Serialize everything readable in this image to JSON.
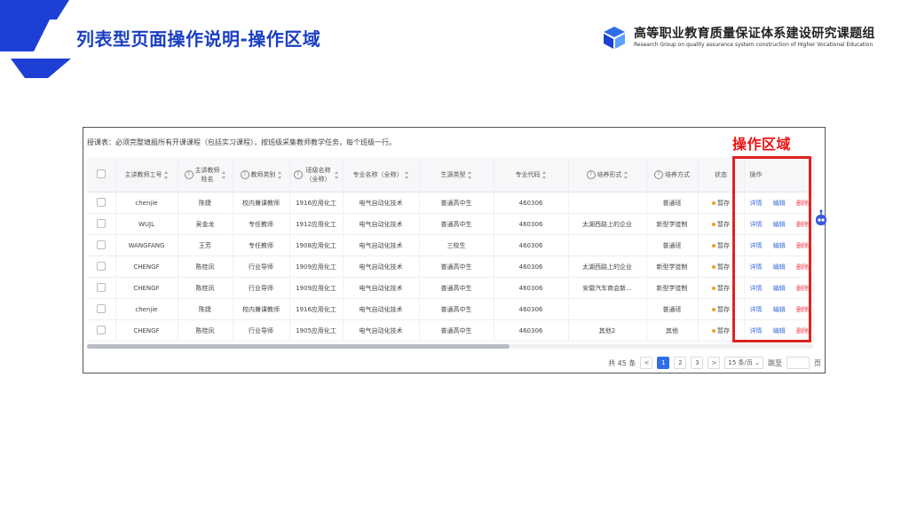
{
  "slide": {
    "title": "列表型页面操作说明-操作区域",
    "org_cn": "高等职业教育质量保证体系建设研究课题组",
    "org_en": "Research Group on quality assurance system construction of Higher Vocational Education",
    "highlight_label": "操作区域",
    "accent_color": "#1a3fc2",
    "highlight_color": "#dd2222"
  },
  "screenshot": {
    "note": "授课表：必须完整填报所有开课课程（包括实习课程），按班级采集教师教学任务，每个班级一行。",
    "columns": [
      {
        "label": "",
        "icon": "checkbox"
      },
      {
        "label": "主讲教师工号",
        "sortable": true
      },
      {
        "label": "主讲教师姓名",
        "help": true,
        "sortable": true
      },
      {
        "label": "教师类别",
        "help": true,
        "sortable": true
      },
      {
        "label": "班级名称（全称）",
        "help": true,
        "sortable": true
      },
      {
        "label": "专业名称（全称）",
        "sortable": true
      },
      {
        "label": "生源类型",
        "sortable": true
      },
      {
        "label": "专业代码",
        "sortable": true
      },
      {
        "label": "培养形式",
        "help": true,
        "sortable": true
      },
      {
        "label": "培养方式",
        "help": true
      },
      {
        "label": "状态"
      },
      {
        "label": "操作"
      }
    ],
    "rows": [
      {
        "id": "chenjie",
        "name": "陈婕",
        "type": "校内兼课教师",
        "class": "1916应用化工",
        "major": "电气自动化技术",
        "source": "普通高中生",
        "code": "460306",
        "form": "",
        "mode": "普通班",
        "status": "暂存"
      },
      {
        "id": "WUJL",
        "name": "吴金龙",
        "type": "专任教师",
        "class": "1912应用化工",
        "major": "电气自动化技术",
        "source": "普通高中生",
        "code": "460306",
        "form": "太湖西路上的企业",
        "mode": "新型学徒制",
        "status": "暂存"
      },
      {
        "id": "WANGFANG",
        "name": "王芳",
        "type": "专任教师",
        "class": "1908应用化工",
        "major": "电气自动化技术",
        "source": "三校生",
        "code": "460306",
        "form": "",
        "mode": "普通班",
        "status": "暂存"
      },
      {
        "id": "CHENGF",
        "name": "陈桂凤",
        "type": "行业导师",
        "class": "1909应用化工",
        "major": "电气自动化技术",
        "source": "普通高中生",
        "code": "460306",
        "form": "太湖西路上的企业",
        "mode": "新型学徒制",
        "status": "暂存"
      },
      {
        "id": "CHENGF",
        "name": "陈桂凤",
        "type": "行业导师",
        "class": "1909应用化工",
        "major": "电气自动化技术",
        "source": "普通高中生",
        "code": "460306",
        "form": "安徽汽车商会新...",
        "mode": "新型学徒制",
        "status": "暂存"
      },
      {
        "id": "chenjie",
        "name": "陈婕",
        "type": "校内兼课教师",
        "class": "1916应用化工",
        "major": "电气自动化技术",
        "source": "普通高中生",
        "code": "460306",
        "form": "",
        "mode": "普通班",
        "status": "暂存"
      },
      {
        "id": "CHENGF",
        "name": "陈桂凤",
        "type": "行业导师",
        "class": "1905应用化工",
        "major": "电气自动化技术",
        "source": "普通高中生",
        "code": "460306",
        "form": "其他2",
        "mode": "其他",
        "status": "暂存"
      }
    ],
    "actions": {
      "detail": "详情",
      "edit": "编辑",
      "delete": "删除"
    },
    "pagination": {
      "total": "共 45 条",
      "prev": "<",
      "pages": [
        "1",
        "2",
        "3"
      ],
      "current": "1",
      "next": ">",
      "page_size": "15 条/页",
      "goto_label": "跳至",
      "goto_suffix": "页"
    }
  }
}
